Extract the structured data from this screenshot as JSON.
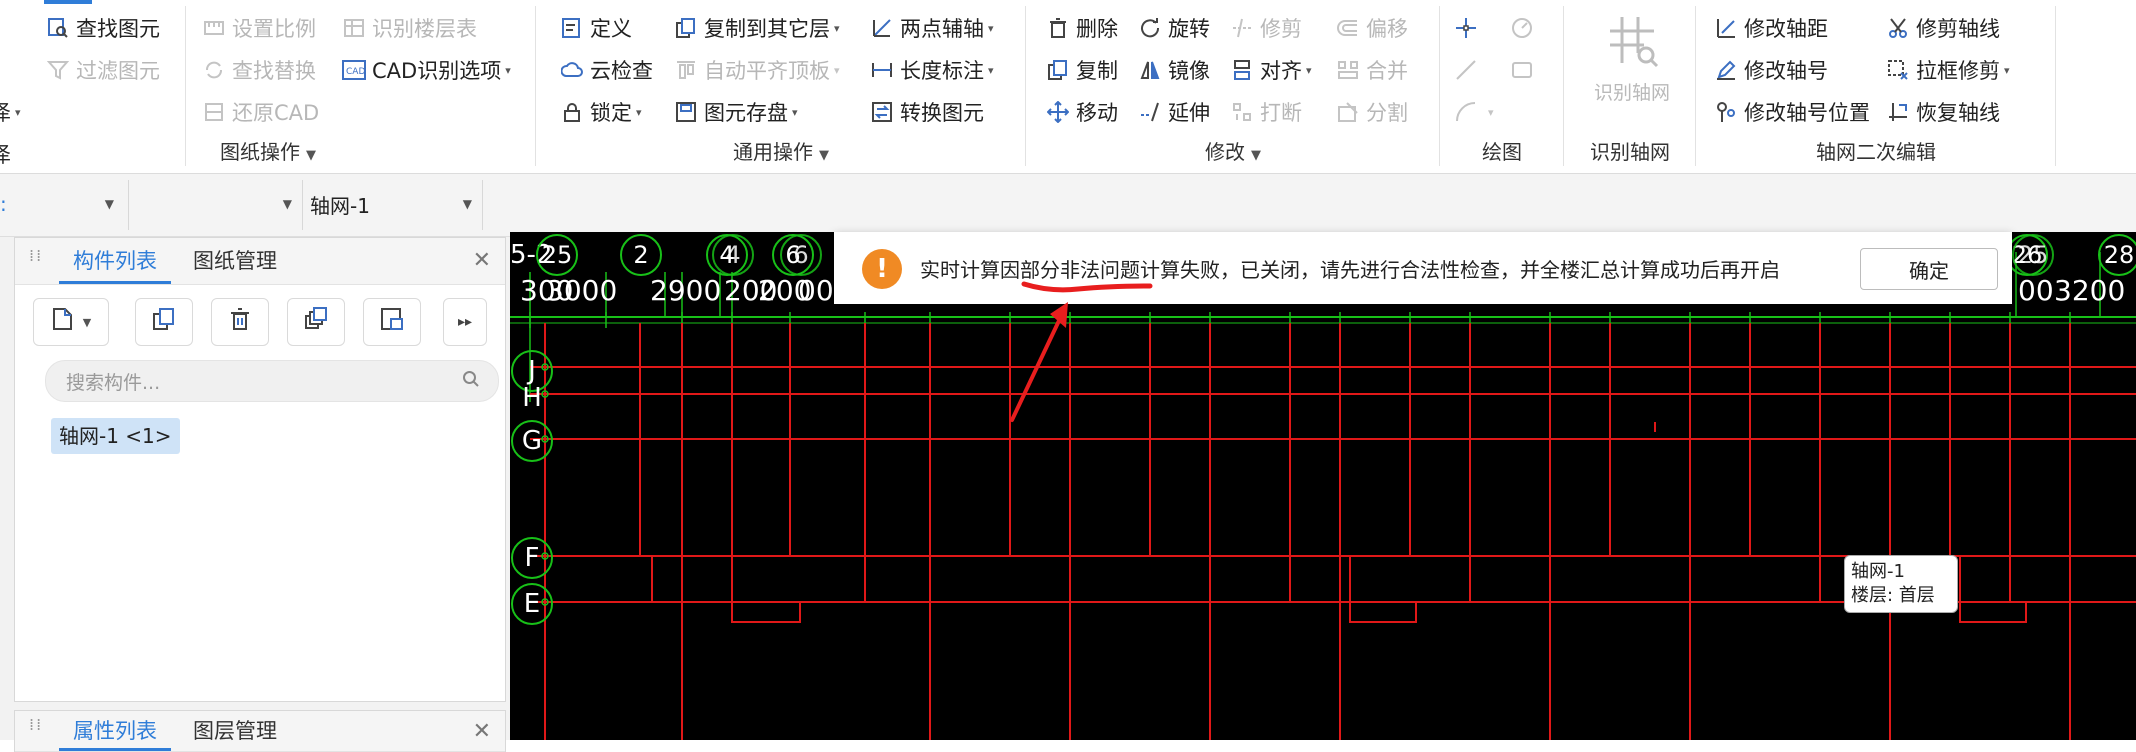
{
  "ribbon": {
    "partial_left": {
      "label_1": "泽",
      "label_2": "泽"
    },
    "group1": {
      "title": "图纸操作",
      "buttons": {
        "find_element": "查找图元",
        "filter_element": "过滤图元",
        "set_scale": "设置比例",
        "identify_floor_table": "识别楼层表",
        "find_replace": "查找替换",
        "cad_options": "CAD识别选项",
        "restore_cad": "还原CAD"
      }
    },
    "group2": {
      "title": "通用操作",
      "buttons": {
        "define": "定义",
        "cloud_check": "云检查",
        "lock": "锁定",
        "copy_to_other_floor": "复制到其它层",
        "auto_align_top": "自动平齐顶板",
        "element_storage": "图元存盘",
        "two_point_axis": "两点辅轴",
        "length_dim": "长度标注",
        "convert_element": "转换图元"
      }
    },
    "group3": {
      "title": "修改",
      "buttons": {
        "delete": "删除",
        "copy": "复制",
        "move": "移动",
        "rotate": "旋转",
        "mirror": "镜像",
        "extend": "延伸",
        "trim": "修剪",
        "align": "对齐",
        "break": "打断",
        "offset": "偏移",
        "merge": "合并",
        "split": "分割"
      }
    },
    "group4": {
      "title": "绘图"
    },
    "group5": {
      "title": "识别轴网",
      "big_button": "识别轴网"
    },
    "group6": {
      "title": "轴网二次编辑",
      "buttons": {
        "modify_axis_distance": "修改轴距",
        "modify_axis_number": "修改轴号",
        "modify_axis_number_position": "修改轴号位置",
        "trim_axis": "修剪轴线",
        "box_trim": "拉框修剪",
        "restore_axis": "恢复轴线"
      }
    }
  },
  "toolbar2": {
    "select_1": "",
    "select_2": "",
    "select_3": "轴网-1"
  },
  "left_panel": {
    "top_panel": {
      "tabs": [
        "构件列表",
        "图纸管理"
      ],
      "search_placeholder": "搜索构件...",
      "item": "轴网-1 <1>"
    },
    "bottom_panel": {
      "tabs": [
        "属性列表",
        "图层管理"
      ]
    }
  },
  "canvas": {
    "top_axis_labels": [
      "5-2",
      "25",
      "2",
      "4",
      "4",
      "6",
      "6",
      "26",
      "25",
      "28"
    ],
    "dims": [
      "300",
      "3000",
      "2900",
      "200",
      "200",
      "00",
      "3",
      "00",
      "3200"
    ],
    "side_axis_labels": [
      "J",
      "H",
      "G",
      "F",
      "E"
    ],
    "tip_line1": "轴网-1",
    "tip_line2": "楼层: 首层"
  },
  "notification": {
    "message": "实时计算因部分非法问题计算失败，已关闭，请先进行合法性检查，并全楼汇总计算成功后再开启",
    "ok_label": "确定",
    "icon": "warning-icon"
  },
  "colors": {
    "accent": "#2f7dd8",
    "canvas_bg": "#000000",
    "grid_red": "#e01818",
    "grid_green": "#18c018",
    "warning": "#f08a24",
    "annotation_red": "#e81e1e"
  }
}
